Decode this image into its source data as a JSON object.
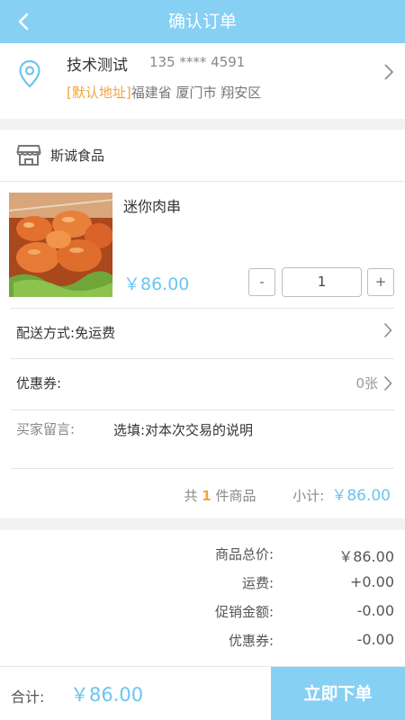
{
  "header": {
    "title": "确认订单",
    "back_icon": "chevron-left-icon"
  },
  "address": {
    "name": "技术测试",
    "phone": "135 **** 4591",
    "default_tag": "[默认地址]",
    "region": "福建省 厦门市 翔安区"
  },
  "shop": {
    "name": "斯诚食品"
  },
  "product": {
    "name": "迷你肉串",
    "price": "￥86.00",
    "quantity": "1",
    "minus_label": "-",
    "plus_label": "+"
  },
  "delivery": {
    "label": "配送方式:",
    "value": "免运费"
  },
  "coupon": {
    "label": "优惠券:",
    "value": "0张"
  },
  "note": {
    "label": "买家留言:",
    "placeholder": "选填:对本次交易的说明"
  },
  "subtotal": {
    "prefix": "共",
    "count": "1",
    "suffix": "件商品",
    "label": "小计:",
    "value": "￥86.00"
  },
  "summary": {
    "rows": [
      {
        "label": "商品总价:",
        "value": "￥86.00"
      },
      {
        "label": "运费:",
        "value": "+0.00"
      },
      {
        "label": "促销金额:",
        "value": "-0.00"
      },
      {
        "label": "优惠券:",
        "value": "-0.00"
      }
    ]
  },
  "footer": {
    "total_label": "合计:",
    "total_value": "￥86.00",
    "submit_label": "立即下单"
  },
  "colors": {
    "accent": "#86d0f3",
    "price": "#6cc5ef",
    "tag": "#f3a33a"
  }
}
